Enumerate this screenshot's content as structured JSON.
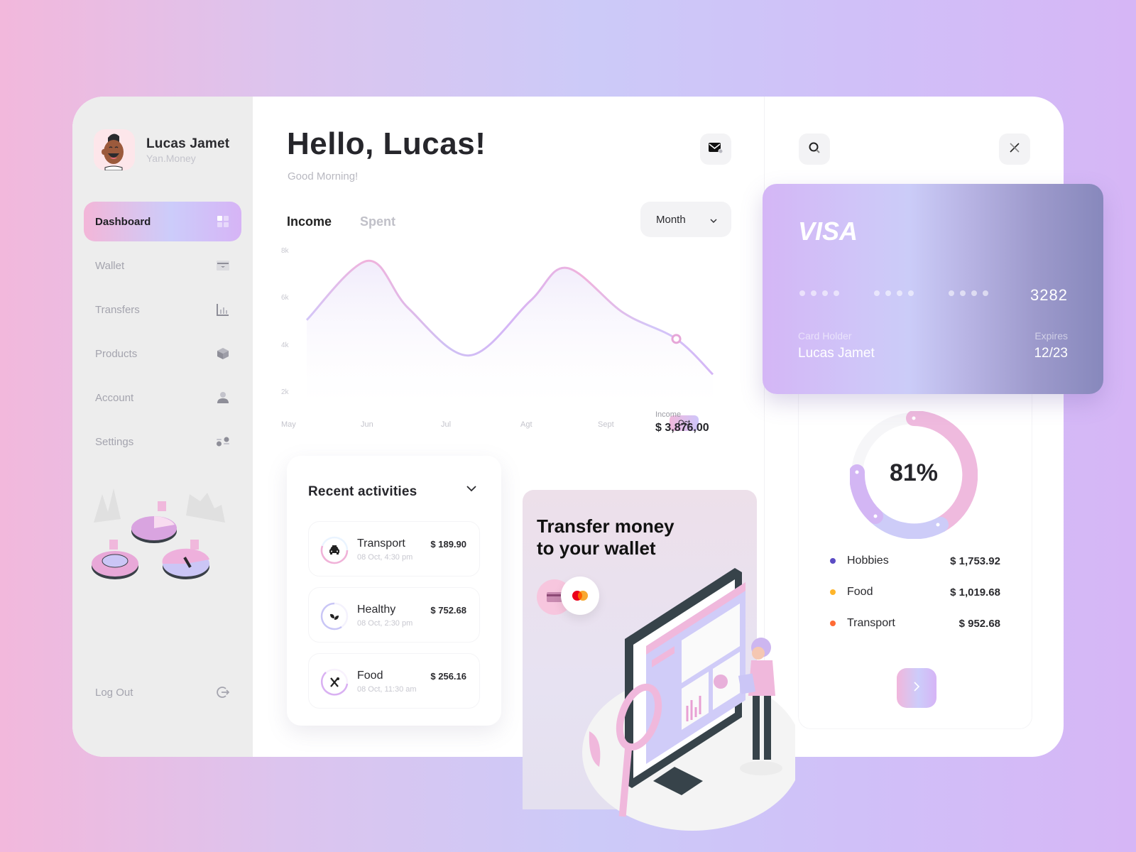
{
  "profile": {
    "name": "Lucas Jamet",
    "subtitle": "Yan.Money"
  },
  "sidebar": {
    "items": [
      {
        "label": "Dashboard",
        "icon": "grid-icon",
        "active": true
      },
      {
        "label": "Wallet",
        "icon": "wallet-icon",
        "active": false
      },
      {
        "label": "Transfers",
        "icon": "bar-chart-icon",
        "active": false
      },
      {
        "label": "Products",
        "icon": "cube-icon",
        "active": false
      },
      {
        "label": "Account",
        "icon": "user-icon",
        "active": false
      },
      {
        "label": "Settings",
        "icon": "settings-icon",
        "active": false
      }
    ],
    "logout_label": "Log Out"
  },
  "header": {
    "greeting": "Hello, Lucas!",
    "subgreeting": "Good Morning!"
  },
  "tabs": {
    "income": "Income",
    "spent": "Spent",
    "active": "Income"
  },
  "period_select": {
    "value": "Month"
  },
  "chart_data": {
    "type": "area",
    "title": "Income",
    "x": [
      "May",
      "Jun",
      "Jul",
      "Agt",
      "Sept",
      "Oct"
    ],
    "active_x": "Oct",
    "y_ticks": [
      "8k",
      "6k",
      "4k",
      "2k"
    ],
    "ylim": [
      2000,
      8000
    ],
    "series": [
      {
        "name": "Income",
        "points": [
          [
            0.0,
            5100
          ],
          [
            0.75,
            7600
          ],
          [
            1.25,
            5600
          ],
          [
            2.0,
            3600
          ],
          [
            2.75,
            5900
          ],
          [
            3.2,
            7300
          ],
          [
            3.9,
            5400
          ],
          [
            4.55,
            4300
          ],
          [
            5.0,
            2800
          ]
        ]
      }
    ],
    "tooltip": {
      "label": "Income",
      "value": "$ 3,876,00"
    },
    "grid": false
  },
  "activities": {
    "title": "Recent activities",
    "items": [
      {
        "name": "Transport",
        "date": "08 Oct, 4:30 pm",
        "amount": "$ 189.90",
        "icon": "car-icon",
        "ring_color": "#f1b2d8"
      },
      {
        "name": "Healthy",
        "date": "08 Oct, 2:30 pm",
        "amount": "$ 752.68",
        "icon": "leaf-icon",
        "ring_color": "#c9c6f6"
      },
      {
        "name": "Food",
        "date": "08 Oct, 11:30 am",
        "amount": "$ 256.16",
        "icon": "utensils-icon",
        "ring_color": "#d9b0f2"
      }
    ]
  },
  "promo": {
    "title_line1": "Transfer money",
    "title_line2": "to your wallet"
  },
  "card": {
    "brand": "VISA",
    "last4": "3282",
    "holder_label": "Card Holder",
    "holder": "Lucas Jamet",
    "expires_label": "Expires",
    "expires": "12/23"
  },
  "spending": {
    "percent": "81%",
    "percent_value": 81,
    "categories": [
      {
        "name": "Hobbies",
        "amount": "$ 1,753.92",
        "color": "#5b4cc4"
      },
      {
        "name": "Food",
        "amount": "$ 1,019.68",
        "color": "#ffb52a"
      },
      {
        "name": "Transport",
        "amount": "$ 952.68",
        "color": "#ff6b35"
      }
    ]
  },
  "colors": {
    "accent_pink": "#f1b6dc",
    "accent_lavender": "#ccccfa",
    "accent_purple": "#d6b4f6"
  }
}
